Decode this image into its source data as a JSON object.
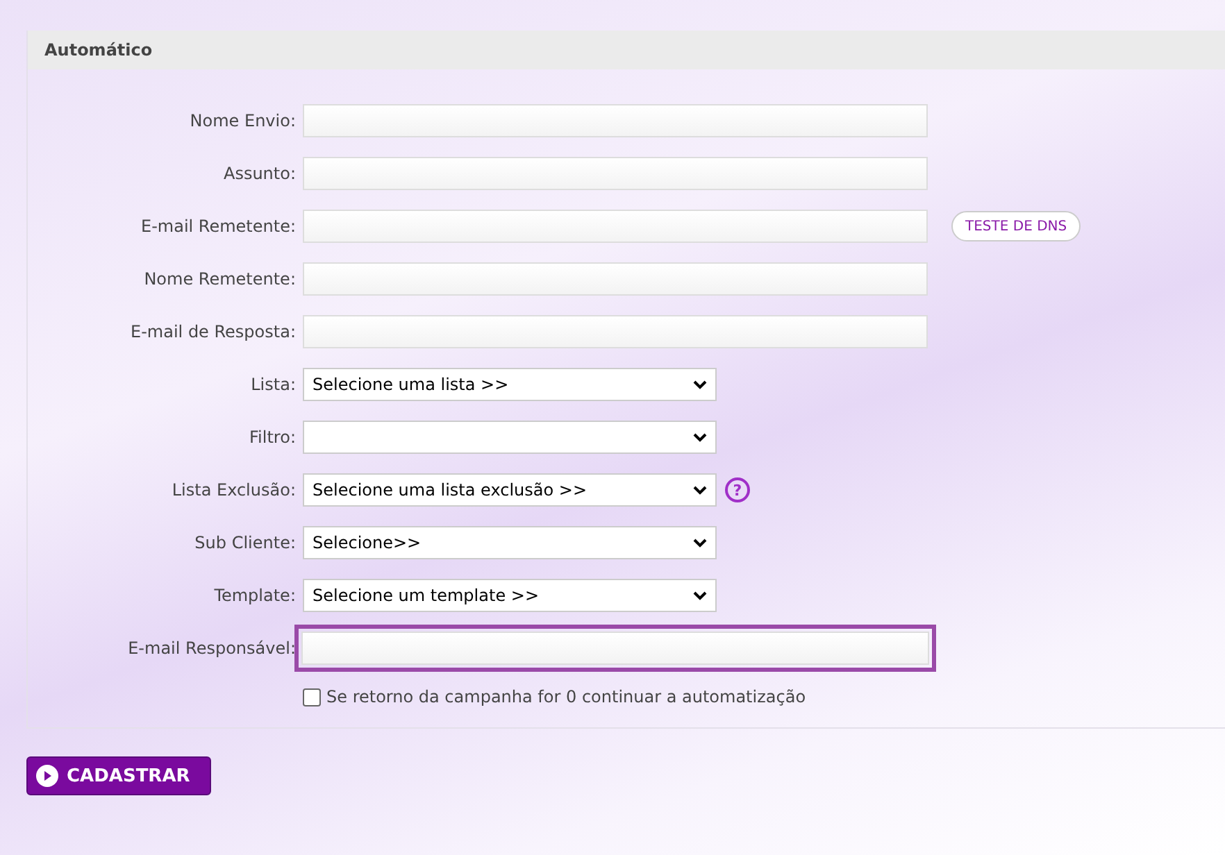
{
  "panel": {
    "title": "Automático"
  },
  "fields": [
    {
      "kind": "text",
      "label": "Nome Envio:",
      "focused": false
    },
    {
      "kind": "text",
      "label": "Assunto:",
      "focused": false
    },
    {
      "kind": "text",
      "label": "E-mail Remetente:",
      "focused": false,
      "action": "TESTE DE DNS"
    },
    {
      "kind": "text",
      "label": "Nome Remetente:",
      "focused": false
    },
    {
      "kind": "text",
      "label": "E-mail de Resposta:",
      "focused": false
    },
    {
      "kind": "select",
      "label": "Lista:",
      "value": "Selecione uma lista >>"
    },
    {
      "kind": "select",
      "label": "Filtro:"
    },
    {
      "kind": "select",
      "label": "Lista Exclusão:",
      "value": "Selecione uma lista exclusão >>",
      "help": "?"
    },
    {
      "kind": "select",
      "label": "Sub Cliente:",
      "value": "Selecione>>"
    },
    {
      "kind": "select",
      "label": "Template:",
      "value": "Selecione um template >>"
    },
    {
      "kind": "text",
      "label": "E-mail Responsável:",
      "focused": true
    }
  ],
  "checkbox": {
    "label": "Se retorno da campanha for 0 continuar a automatização",
    "checked": false
  },
  "submit": {
    "label": "CADASTRAR"
  }
}
